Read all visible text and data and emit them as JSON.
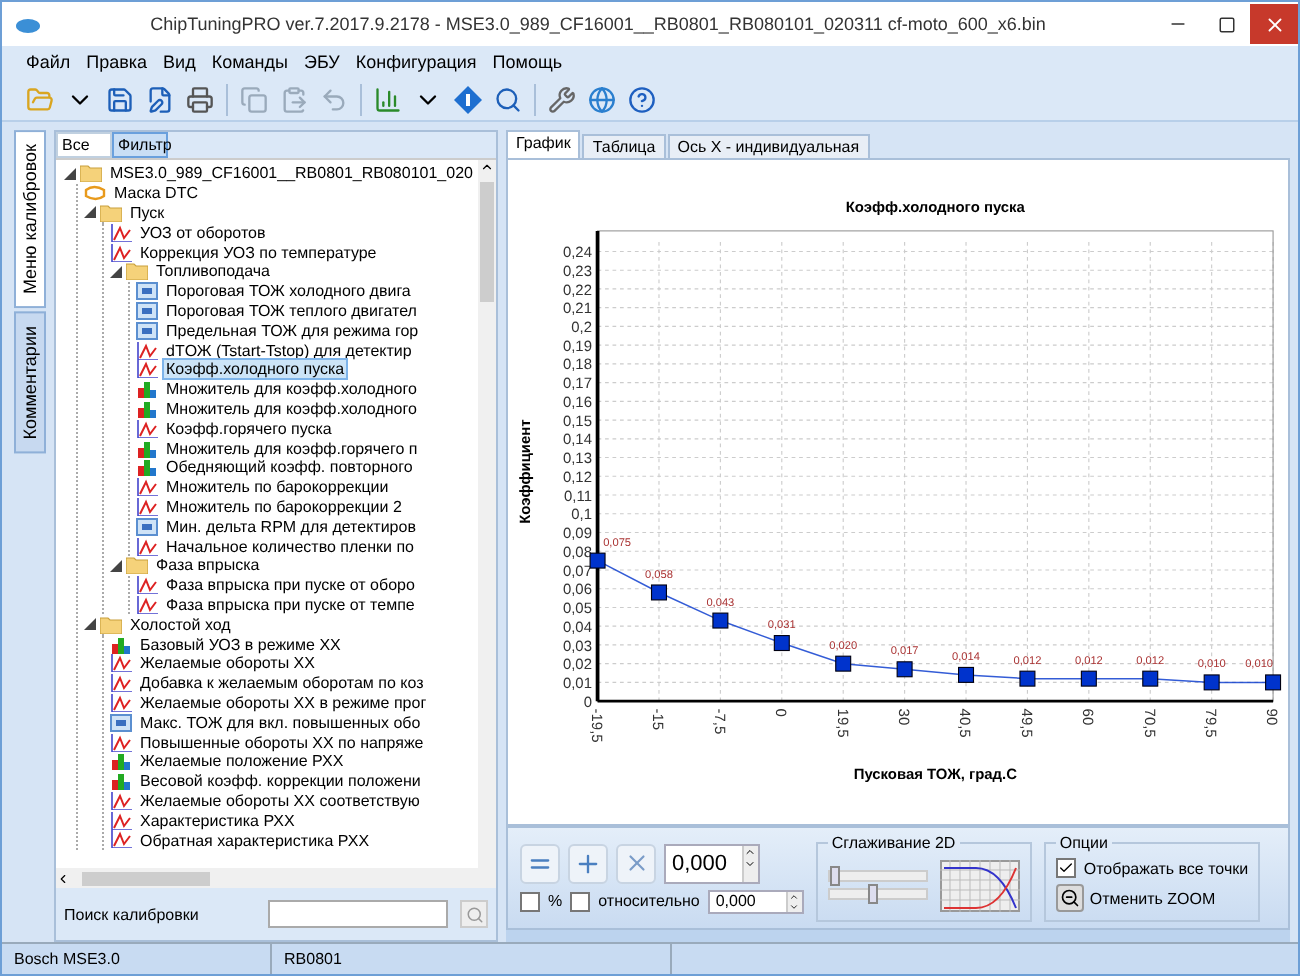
{
  "window": {
    "title": "ChipTuningPRO ver.7.2017.9.2178 - MSE3.0_989_CF16001__RB0801_RB080101_020311 cf-moto_600_x6.bin"
  },
  "menu": [
    "Файл",
    "Правка",
    "Вид",
    "Команды",
    "ЭБУ",
    "Конфигурация",
    "Помощь"
  ],
  "side_tabs": [
    {
      "label": "Меню калибровок",
      "selected": true
    },
    {
      "label": "Комментарии",
      "selected": false
    }
  ],
  "tree_tabs": [
    {
      "label": "Все",
      "selected": false
    },
    {
      "label": "Фильтр",
      "selected": true
    }
  ],
  "tree": [
    {
      "label": "MSE3.0_989_CF16001__RB0801_RB080101_020",
      "kind": "folder",
      "selected": false,
      "children": [
        {
          "label": "Маска DTC",
          "kind": "mask",
          "selected": false
        },
        {
          "label": "Пуск",
          "kind": "folder",
          "selected": false,
          "children": [
            {
              "label": "УОЗ от оборотов",
              "kind": "curve",
              "selected": false
            },
            {
              "label": "Коррекция УОЗ по температуре",
              "kind": "curve",
              "selected": false
            },
            {
              "label": "Топливоподача",
              "kind": "folder",
              "selected": false,
              "children": [
                {
                  "label": "Пороговая ТОЖ холодного двига",
                  "kind": "value",
                  "selected": false
                },
                {
                  "label": "Пороговая ТОЖ теплого двигател",
                  "kind": "value",
                  "selected": false
                },
                {
                  "label": "Предельная ТОЖ для режима гор",
                  "kind": "value",
                  "selected": false
                },
                {
                  "label": "dTОЖ (Tstart-Tstop) для детектир",
                  "kind": "curve",
                  "selected": false
                },
                {
                  "label": "Коэфф.холодного пуска",
                  "kind": "curve",
                  "selected": true
                },
                {
                  "label": "Множитель для коэфф.холодного",
                  "kind": "map",
                  "selected": false
                },
                {
                  "label": "Множитель для коэфф.холодного",
                  "kind": "map",
                  "selected": false
                },
                {
                  "label": "Коэфф.горячего пуска",
                  "kind": "curve",
                  "selected": false
                },
                {
                  "label": "Множитель для коэфф.горячего п",
                  "kind": "map",
                  "selected": false
                },
                {
                  "label": "Обедняющий коэфф. повторного",
                  "kind": "map",
                  "selected": false
                },
                {
                  "label": "Множитель по барокоррекции",
                  "kind": "curve",
                  "selected": false
                },
                {
                  "label": "Множитель по барокоррекции 2",
                  "kind": "curve",
                  "selected": false
                },
                {
                  "label": "Мин. дельта RPM для детектиров",
                  "kind": "value",
                  "selected": false
                },
                {
                  "label": "Начальное количество пленки по",
                  "kind": "curve",
                  "selected": false
                }
              ]
            },
            {
              "label": "Фаза впрыска",
              "kind": "folder",
              "selected": false,
              "children": [
                {
                  "label": "Фаза впрыска при пуске от оборо",
                  "kind": "curve",
                  "selected": false
                },
                {
                  "label": "Фаза впрыска при пуске от темпе",
                  "kind": "curve",
                  "selected": false
                }
              ]
            }
          ]
        },
        {
          "label": "Холостой ход",
          "kind": "folder",
          "selected": false,
          "children": [
            {
              "label": "Базовый УОЗ в режиме ХХ",
              "kind": "map",
              "selected": false
            },
            {
              "label": "Желаемые обороты ХХ",
              "kind": "curve",
              "selected": false
            },
            {
              "label": "Добавка к желаемым оборотам по коз",
              "kind": "curve",
              "selected": false
            },
            {
              "label": "Желаемые обороты ХХ в режиме прог",
              "kind": "curve",
              "selected": false
            },
            {
              "label": "Макс. ТОЖ для вкл. повышенных обо",
              "kind": "value",
              "selected": false
            },
            {
              "label": "Повышенные обороты ХХ по напряже",
              "kind": "curve",
              "selected": false
            },
            {
              "label": "Желаемые положение РХХ",
              "kind": "map",
              "selected": false
            },
            {
              "label": "Весовой коэфф. коррекции положени",
              "kind": "map",
              "selected": false
            },
            {
              "label": "Желаемые обороты ХХ соответствую",
              "kind": "curve",
              "selected": false
            },
            {
              "label": "Характеристика РХХ",
              "kind": "curve",
              "selected": false
            },
            {
              "label": "Обратная характеристика РХХ",
              "kind": "curve",
              "selected": false
            }
          ]
        }
      ]
    }
  ],
  "search": {
    "label": "Поиск калибровки"
  },
  "view_tabs": [
    {
      "label": "График",
      "selected": true
    },
    {
      "label": "Таблица",
      "selected": false
    },
    {
      "label": "Ось X - индивидуальная",
      "selected": false
    }
  ],
  "chart": {
    "chart_data": {
      "type": "line",
      "title": "Коэфф.холодного пуска",
      "xlabel": "Пусковая ТОЖ, град.С",
      "ylabel": "Коэффициент",
      "categories": [
        "-19,5",
        "-15",
        "-7,5",
        "0",
        "19,5",
        "30",
        "40,5",
        "49,5",
        "60",
        "70,5",
        "79,5",
        "90"
      ],
      "grid": true,
      "series": [
        {
          "color": "#0033cc",
          "marker": "square",
          "values": [
            0.075,
            0.058,
            0.043,
            0.031,
            0.02,
            0.017,
            0.014,
            0.012,
            0.012,
            0.012,
            0.01,
            0.01
          ]
        }
      ],
      "value_labels": [
        "0,075",
        "0,058",
        "0,043",
        "0,031",
        "0,020",
        "0,017",
        "0,014",
        "0,012",
        "0,012",
        "0,012",
        "0,010",
        "0,010"
      ],
      "ylim": [
        0,
        0.245
      ],
      "yticks": [
        {
          "value": 0,
          "label": "0"
        },
        {
          "value": 0.01,
          "label": "0,01"
        },
        {
          "value": 0.02,
          "label": "0,02"
        },
        {
          "value": 0.03,
          "label": "0,03"
        },
        {
          "value": 0.04,
          "label": "0,04"
        },
        {
          "value": 0.05,
          "label": "0,05"
        },
        {
          "value": 0.06,
          "label": "0,06"
        },
        {
          "value": 0.07,
          "label": "0,07"
        },
        {
          "value": 0.08,
          "label": "0,08"
        },
        {
          "value": 0.09,
          "label": "0,09"
        },
        {
          "value": 0.1,
          "label": "0,1"
        },
        {
          "value": 0.11,
          "label": "0,11"
        },
        {
          "value": 0.12,
          "label": "0,12"
        },
        {
          "value": 0.13,
          "label": "0,13"
        },
        {
          "value": 0.14,
          "label": "0,14"
        },
        {
          "value": 0.15,
          "label": "0,15"
        },
        {
          "value": 0.16,
          "label": "0,16"
        },
        {
          "value": 0.17,
          "label": "0,17"
        },
        {
          "value": 0.18,
          "label": "0,18"
        },
        {
          "value": 0.19,
          "label": "0,19"
        },
        {
          "value": 0.2,
          "label": "0,2"
        },
        {
          "value": 0.21,
          "label": "0,21"
        },
        {
          "value": 0.22,
          "label": "0,22"
        },
        {
          "value": 0.23,
          "label": "0,23"
        },
        {
          "value": 0.24,
          "label": "0,24"
        }
      ]
    }
  },
  "controls": {
    "value": "0,000",
    "percent": {
      "label": "%",
      "checked": false
    },
    "relative": {
      "label": "относительно",
      "checked": false
    },
    "relative_value": "0,000",
    "smoothing": {
      "title": "Сглаживание 2D",
      "sliders": [
        {
          "level": 0.04
        },
        {
          "level": 0.45
        }
      ]
    },
    "options": {
      "title": "Опции",
      "show_all_points": {
        "label": "Отображать все точки",
        "checked": true
      },
      "reset_zoom": "Отменить ZOOM"
    }
  },
  "status_bar": [
    "Bosch MSE3.0",
    "RB0801"
  ]
}
